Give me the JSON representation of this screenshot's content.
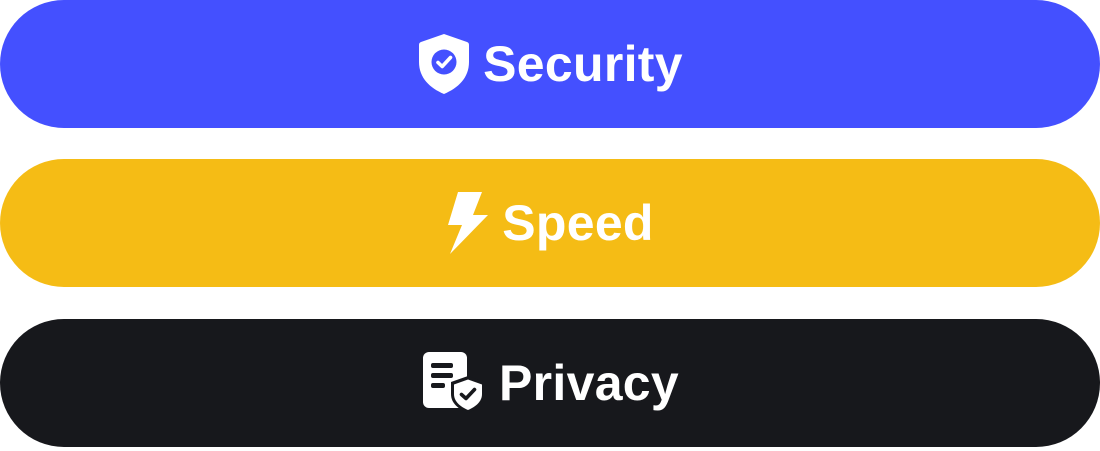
{
  "buttons": {
    "security": {
      "label": "Security",
      "icon": "shield-check-icon",
      "color": "#4450FF"
    },
    "speed": {
      "label": "Speed",
      "icon": "lightning-bolt-icon",
      "color": "#F5BC15"
    },
    "privacy": {
      "label": "Privacy",
      "icon": "document-shield-icon",
      "color": "#17181C"
    }
  }
}
